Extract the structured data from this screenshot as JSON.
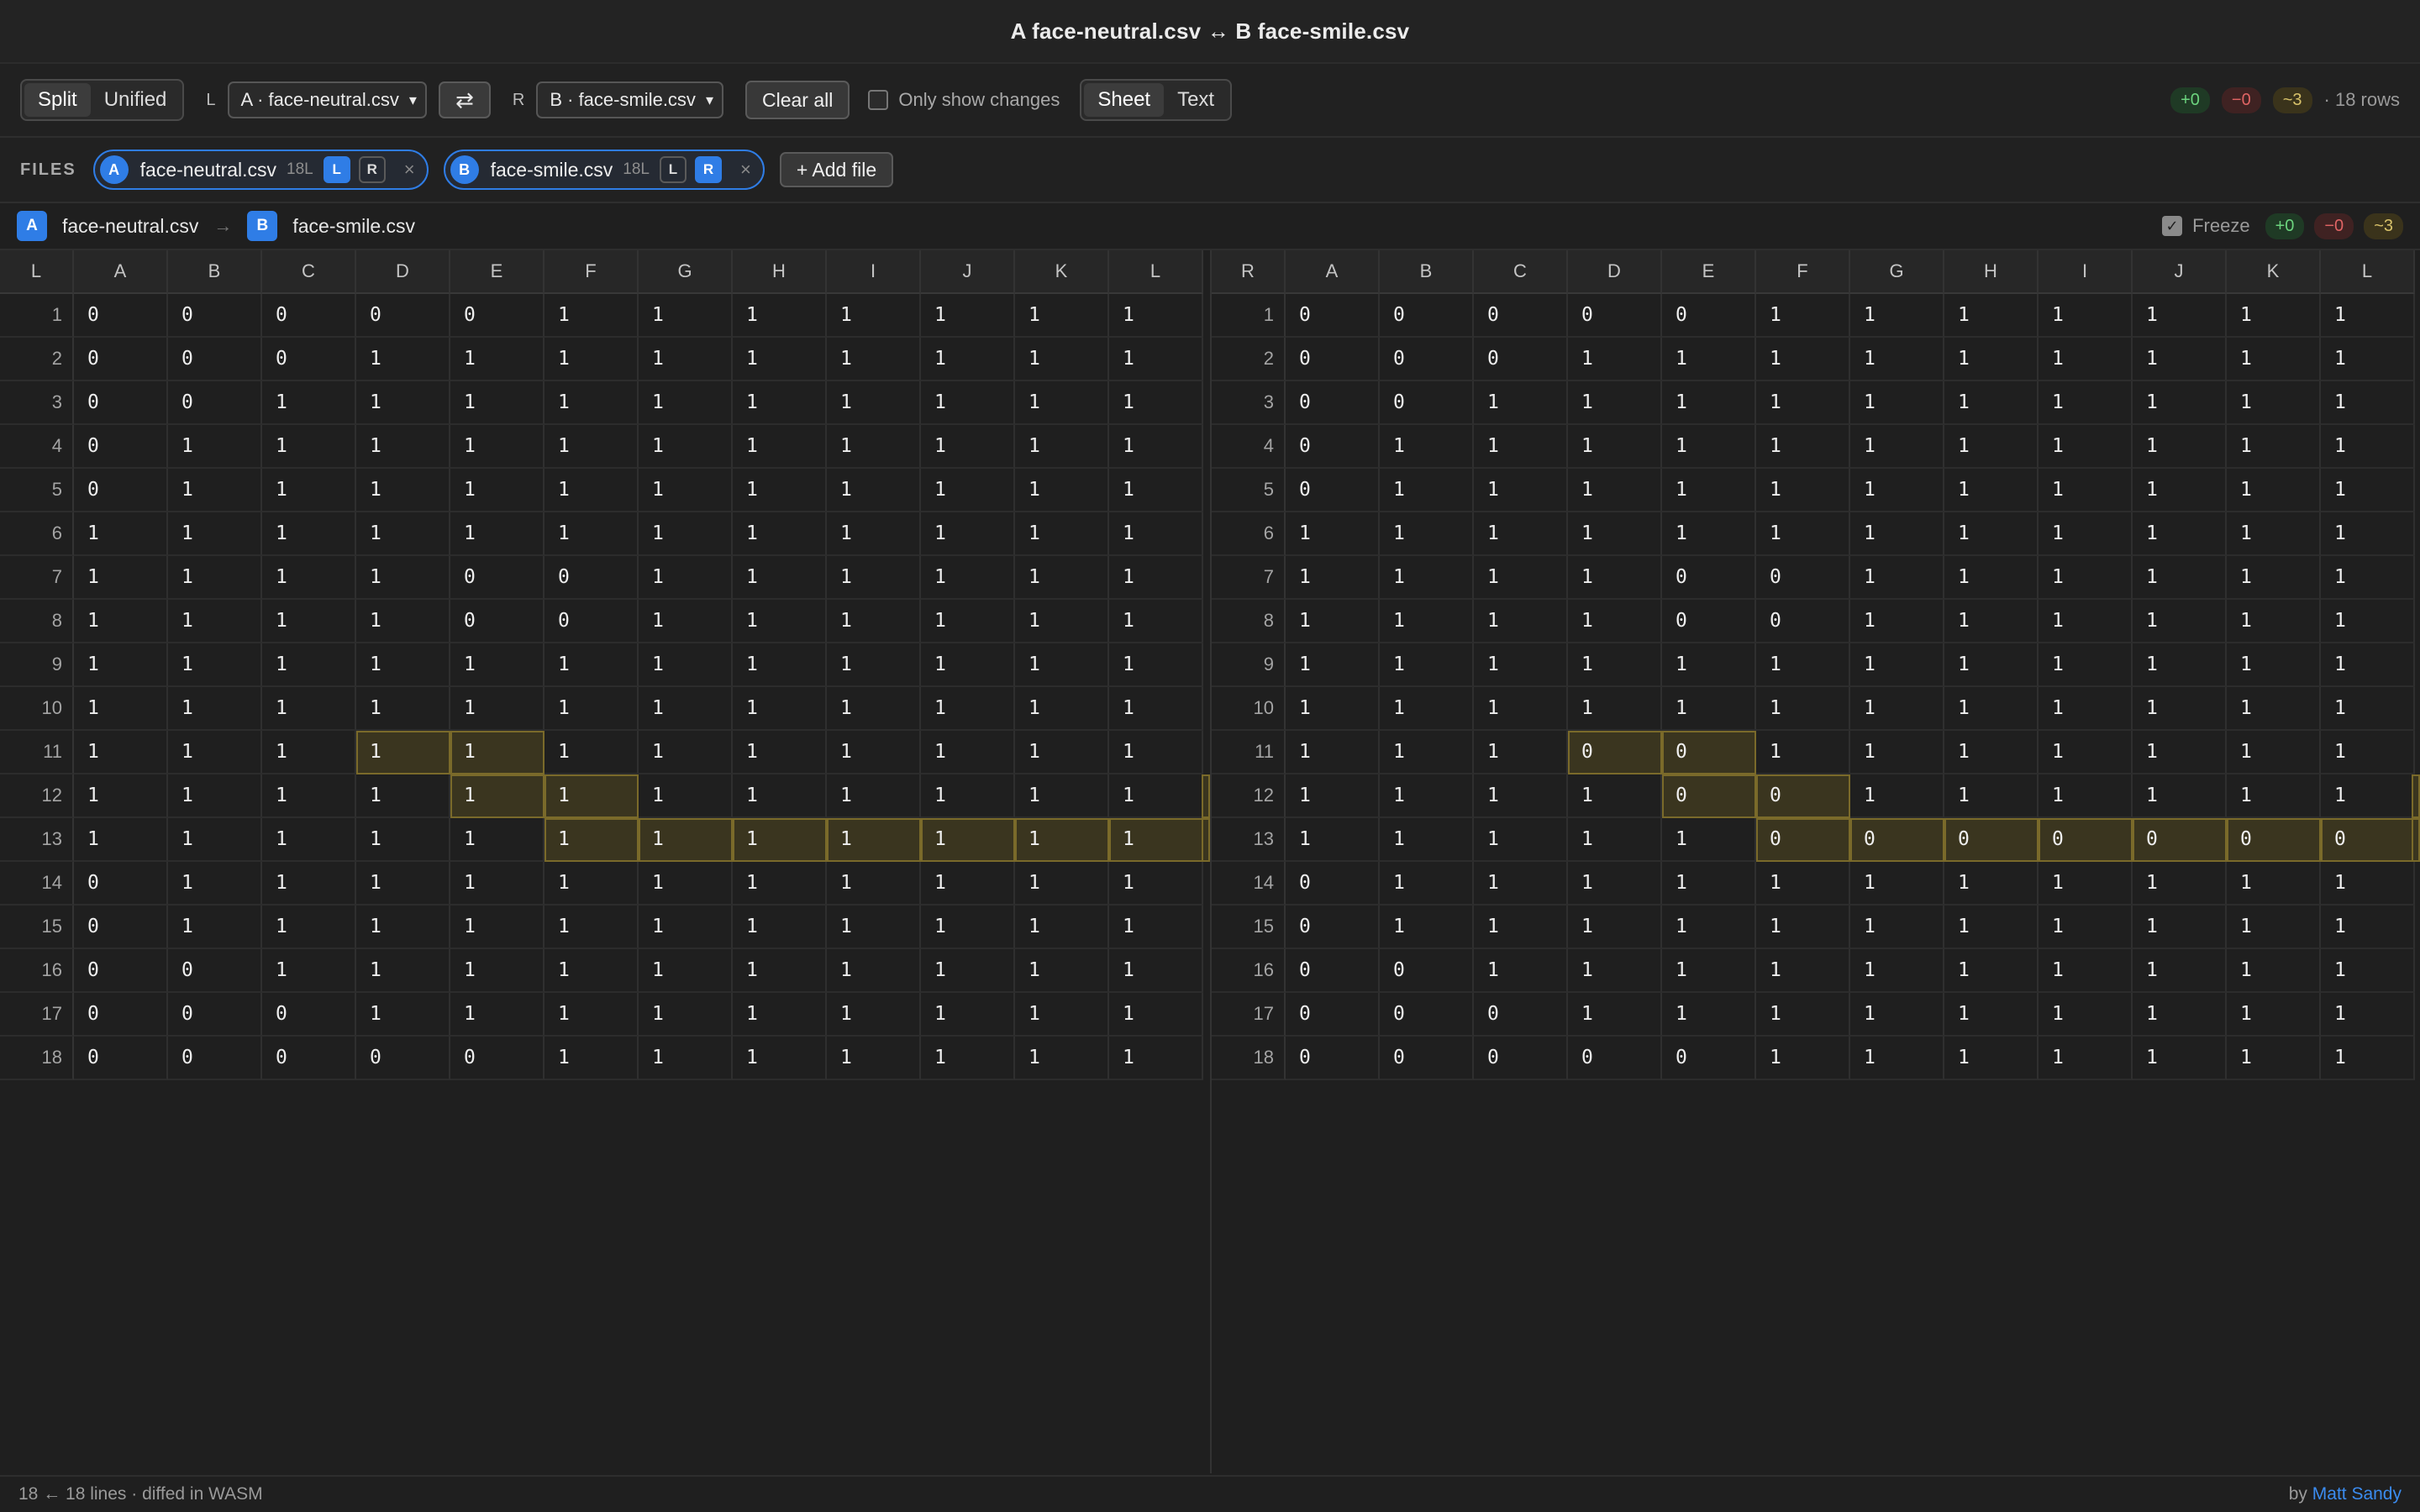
{
  "window": {
    "title": "A face-neutral.csv ↔ B face-smile.csv"
  },
  "toolbar": {
    "view_modes": [
      "Split",
      "Unified"
    ],
    "active_view": "Split",
    "left_label": "L",
    "left_select": "A · face-neutral.csv",
    "right_label": "R",
    "right_select": "B · face-smile.csv",
    "swap_icon": "⇄",
    "clear_label": "Clear all",
    "only_changes_label": "Only show changes",
    "format_modes": [
      "Sheet",
      "Text"
    ],
    "active_format": "Sheet",
    "added": "+0",
    "removed": "−0",
    "modified": "~3",
    "rows_text": "· 18 rows"
  },
  "files": {
    "label": "FILES",
    "items": [
      {
        "badge": "A",
        "name": "face-neutral.csv",
        "lines": "18L",
        "l": "L",
        "r": "R",
        "active": "L",
        "close": "×"
      },
      {
        "badge": "B",
        "name": "face-smile.csv",
        "lines": "18L",
        "l": "L",
        "r": "R",
        "active": "R",
        "close": "×"
      }
    ],
    "add_label": "+ Add file"
  },
  "compare": {
    "left_badge": "A",
    "left_name": "face-neutral.csv",
    "arrow": "→",
    "right_badge": "B",
    "right_name": "face-smile.csv",
    "freeze_label": "Freeze",
    "freeze_checked": "✓",
    "added": "+0",
    "removed": "−0",
    "modified": "~3"
  },
  "grid": {
    "left_corner": "L",
    "right_corner": "R",
    "columns": [
      "A",
      "B",
      "C",
      "D",
      "E",
      "F",
      "G",
      "H",
      "I",
      "J",
      "K",
      "L"
    ],
    "left_rows": [
      [
        "0",
        "0",
        "0",
        "0",
        "0",
        "1",
        "1",
        "1",
        "1",
        "1",
        "1",
        "1"
      ],
      [
        "0",
        "0",
        "0",
        "1",
        "1",
        "1",
        "1",
        "1",
        "1",
        "1",
        "1",
        "1"
      ],
      [
        "0",
        "0",
        "1",
        "1",
        "1",
        "1",
        "1",
        "1",
        "1",
        "1",
        "1",
        "1"
      ],
      [
        "0",
        "1",
        "1",
        "1",
        "1",
        "1",
        "1",
        "1",
        "1",
        "1",
        "1",
        "1"
      ],
      [
        "0",
        "1",
        "1",
        "1",
        "1",
        "1",
        "1",
        "1",
        "1",
        "1",
        "1",
        "1"
      ],
      [
        "1",
        "1",
        "1",
        "1",
        "1",
        "1",
        "1",
        "1",
        "1",
        "1",
        "1",
        "1"
      ],
      [
        "1",
        "1",
        "1",
        "1",
        "0",
        "0",
        "1",
        "1",
        "1",
        "1",
        "1",
        "1"
      ],
      [
        "1",
        "1",
        "1",
        "1",
        "0",
        "0",
        "1",
        "1",
        "1",
        "1",
        "1",
        "1"
      ],
      [
        "1",
        "1",
        "1",
        "1",
        "1",
        "1",
        "1",
        "1",
        "1",
        "1",
        "1",
        "1"
      ],
      [
        "1",
        "1",
        "1",
        "1",
        "1",
        "1",
        "1",
        "1",
        "1",
        "1",
        "1",
        "1"
      ],
      [
        "1",
        "1",
        "1",
        "1",
        "1",
        "1",
        "1",
        "1",
        "1",
        "1",
        "1",
        "1"
      ],
      [
        "1",
        "1",
        "1",
        "1",
        "1",
        "1",
        "1",
        "1",
        "1",
        "1",
        "1",
        "1"
      ],
      [
        "1",
        "1",
        "1",
        "1",
        "1",
        "1",
        "1",
        "1",
        "1",
        "1",
        "1",
        "1"
      ],
      [
        "0",
        "1",
        "1",
        "1",
        "1",
        "1",
        "1",
        "1",
        "1",
        "1",
        "1",
        "1"
      ],
      [
        "0",
        "1",
        "1",
        "1",
        "1",
        "1",
        "1",
        "1",
        "1",
        "1",
        "1",
        "1"
      ],
      [
        "0",
        "0",
        "1",
        "1",
        "1",
        "1",
        "1",
        "1",
        "1",
        "1",
        "1",
        "1"
      ],
      [
        "0",
        "0",
        "0",
        "1",
        "1",
        "1",
        "1",
        "1",
        "1",
        "1",
        "1",
        "1"
      ],
      [
        "0",
        "0",
        "0",
        "0",
        "0",
        "1",
        "1",
        "1",
        "1",
        "1",
        "1",
        "1"
      ]
    ],
    "right_rows": [
      [
        "0",
        "0",
        "0",
        "0",
        "0",
        "1",
        "1",
        "1",
        "1",
        "1",
        "1",
        "1"
      ],
      [
        "0",
        "0",
        "0",
        "1",
        "1",
        "1",
        "1",
        "1",
        "1",
        "1",
        "1",
        "1"
      ],
      [
        "0",
        "0",
        "1",
        "1",
        "1",
        "1",
        "1",
        "1",
        "1",
        "1",
        "1",
        "1"
      ],
      [
        "0",
        "1",
        "1",
        "1",
        "1",
        "1",
        "1",
        "1",
        "1",
        "1",
        "1",
        "1"
      ],
      [
        "0",
        "1",
        "1",
        "1",
        "1",
        "1",
        "1",
        "1",
        "1",
        "1",
        "1",
        "1"
      ],
      [
        "1",
        "1",
        "1",
        "1",
        "1",
        "1",
        "1",
        "1",
        "1",
        "1",
        "1",
        "1"
      ],
      [
        "1",
        "1",
        "1",
        "1",
        "0",
        "0",
        "1",
        "1",
        "1",
        "1",
        "1",
        "1"
      ],
      [
        "1",
        "1",
        "1",
        "1",
        "0",
        "0",
        "1",
        "1",
        "1",
        "1",
        "1",
        "1"
      ],
      [
        "1",
        "1",
        "1",
        "1",
        "1",
        "1",
        "1",
        "1",
        "1",
        "1",
        "1",
        "1"
      ],
      [
        "1",
        "1",
        "1",
        "1",
        "1",
        "1",
        "1",
        "1",
        "1",
        "1",
        "1",
        "1"
      ],
      [
        "1",
        "1",
        "1",
        "0",
        "0",
        "1",
        "1",
        "1",
        "1",
        "1",
        "1",
        "1"
      ],
      [
        "1",
        "1",
        "1",
        "1",
        "0",
        "0",
        "1",
        "1",
        "1",
        "1",
        "1",
        "1"
      ],
      [
        "1",
        "1",
        "1",
        "1",
        "1",
        "0",
        "0",
        "0",
        "0",
        "0",
        "0",
        "0"
      ],
      [
        "0",
        "1",
        "1",
        "1",
        "1",
        "1",
        "1",
        "1",
        "1",
        "1",
        "1",
        "1"
      ],
      [
        "0",
        "1",
        "1",
        "1",
        "1",
        "1",
        "1",
        "1",
        "1",
        "1",
        "1",
        "1"
      ],
      [
        "0",
        "0",
        "1",
        "1",
        "1",
        "1",
        "1",
        "1",
        "1",
        "1",
        "1",
        "1"
      ],
      [
        "0",
        "0",
        "0",
        "1",
        "1",
        "1",
        "1",
        "1",
        "1",
        "1",
        "1",
        "1"
      ],
      [
        "0",
        "0",
        "0",
        "0",
        "0",
        "1",
        "1",
        "1",
        "1",
        "1",
        "1",
        "1"
      ]
    ],
    "changed_cells": [
      [
        11,
        3
      ],
      [
        11,
        4
      ],
      [
        12,
        4
      ],
      [
        12,
        5
      ],
      [
        13,
        5
      ],
      [
        13,
        6
      ],
      [
        13,
        7
      ],
      [
        13,
        8
      ],
      [
        13,
        9
      ],
      [
        13,
        10
      ],
      [
        13,
        11
      ]
    ],
    "changed_overflow_rows": [
      12,
      13
    ]
  },
  "footer": {
    "info": "18 ← 18 lines · diffed in WASM",
    "credit_prefix": "by",
    "credit_name": "Matt Sandy"
  }
}
